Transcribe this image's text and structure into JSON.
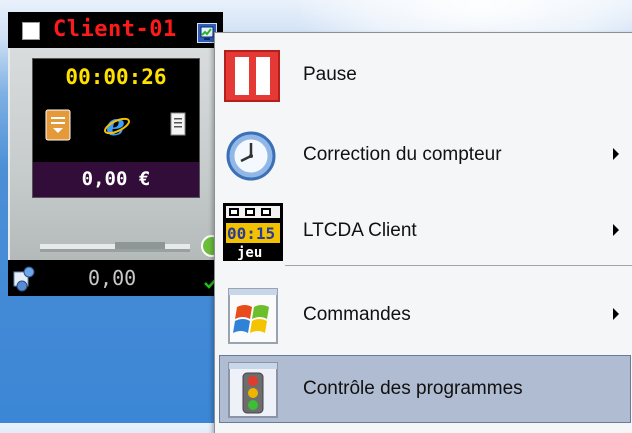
{
  "client_tile": {
    "name": "Client-01",
    "timer": "00:00:26",
    "price": "0,00 €",
    "balance": "0,00",
    "checkbox_checked": false
  },
  "context_menu": {
    "items": [
      {
        "label": "Pause",
        "icon": "pause-icon",
        "has_submenu": false,
        "highlighted": false
      },
      {
        "label": "Correction du compteur",
        "icon": "clock-icon",
        "has_submenu": true,
        "highlighted": false
      },
      {
        "label": "LTCDA Client",
        "icon": "ltcda-timer-icon",
        "icon_text_top": "00:15",
        "icon_text_bottom": "jeu",
        "has_submenu": true,
        "highlighted": false
      },
      {
        "label": "Commandes",
        "icon": "windows-document-icon",
        "has_submenu": true,
        "highlighted": false
      },
      {
        "label": "Contrôle des programmes",
        "icon": "traffic-light-icon",
        "has_submenu": false,
        "highlighted": true
      }
    ]
  },
  "colors": {
    "client_name": "#ff1a1a",
    "timer": "#ffe000",
    "highlight": "#b0bcd2",
    "pause_red": "#e53935"
  }
}
